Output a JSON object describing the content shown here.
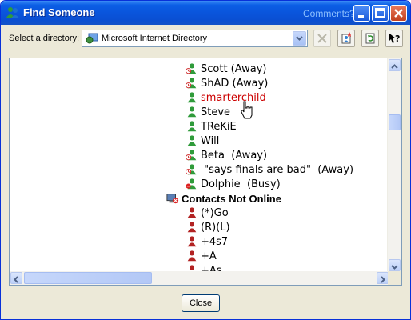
{
  "window": {
    "title": "Find Someone",
    "comments_link": "Comments?"
  },
  "directory": {
    "label": "Select a directory:",
    "selected": "Microsoft Internet Directory"
  },
  "toolbar_icons": [
    "stop-icon",
    "add-contact-icon",
    "refresh-icon",
    "help-icon"
  ],
  "contacts": [
    {
      "name": "Scott (Away)",
      "status": "away",
      "indent": 1
    },
    {
      "name": "ShAD (Away)",
      "status": "away",
      "indent": 1
    },
    {
      "name": "smarterchild",
      "status": "online",
      "indent": 1,
      "link": true
    },
    {
      "name": "Steve",
      "status": "online",
      "indent": 1
    },
    {
      "name": "TReKiE",
      "status": "online",
      "indent": 1
    },
    {
      "name": "Will",
      "status": "online",
      "indent": 1
    },
    {
      "name": "Beta  (Away)",
      "status": "away",
      "indent": 1
    },
    {
      "name": " \"says finals are bad\"  (Away)",
      "status": "away",
      "indent": 1
    },
    {
      "name": "Dolphie  (Busy)",
      "status": "busy",
      "indent": 1
    },
    {
      "name": "Contacts Not Online",
      "status": "group",
      "indent": 0
    },
    {
      "name": "(*)Go",
      "status": "offline",
      "indent": 1
    },
    {
      "name": "(R)(L)",
      "status": "offline",
      "indent": 1
    },
    {
      "name": "+4s7",
      "status": "offline",
      "indent": 1
    },
    {
      "name": "+A",
      "status": "offline",
      "indent": 1
    },
    {
      "name": "+As",
      "status": "offline",
      "indent": 1
    }
  ],
  "footer": {
    "close_label": "Close"
  },
  "colors": {
    "title_bar": "#0a55dc",
    "link": "#cc0000",
    "online": "#2f9b3a",
    "away": "#2f9b3a",
    "offline": "#b22222"
  }
}
